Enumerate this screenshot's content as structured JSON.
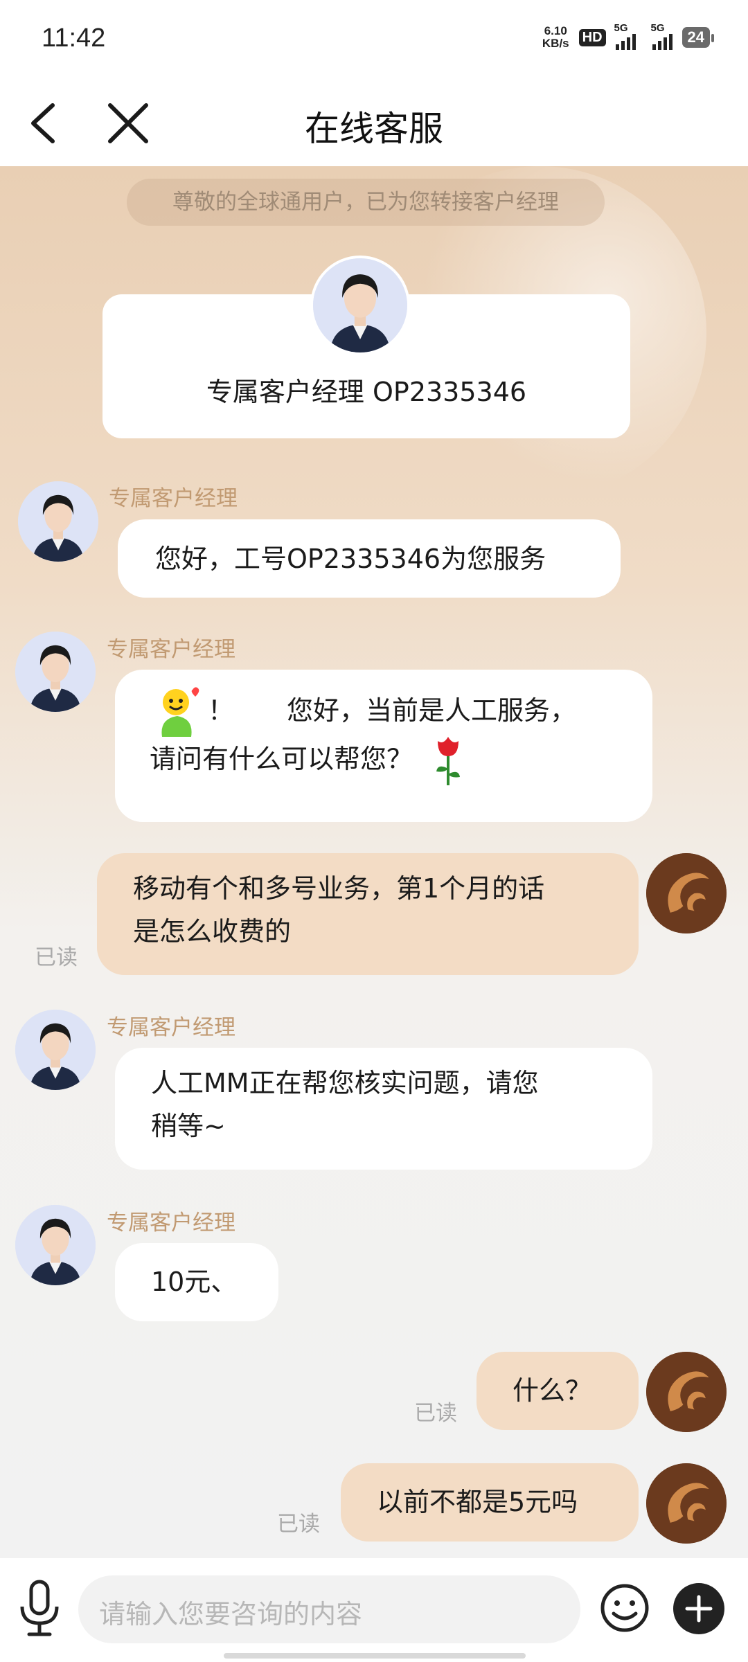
{
  "status_bar": {
    "time": "11:42",
    "net_speed_value": "6.10",
    "net_speed_unit": "KB/s",
    "hd_badge": "HD",
    "signal_1": "5G",
    "signal_2": "5G",
    "battery": "24"
  },
  "header": {
    "title": "在线客服",
    "back_icon": "chevron-left-icon",
    "close_icon": "close-icon"
  },
  "chat": {
    "notice": "尊敬的全球通用户，已为您转接客户经理",
    "manager_card": {
      "name": "专属客户经理 OP2335346"
    },
    "messages": [
      {
        "from": "agent",
        "sender": "专属客户经理",
        "text": "您好，工号OP2335346为您服务"
      },
      {
        "from": "agent",
        "sender": "专属客户经理",
        "line1": "！　　您好，当前是人工服务，",
        "line2": "请问有什么可以帮您？",
        "emoji_1": "waving-smiley-icon",
        "emoji_2": "rose-icon"
      },
      {
        "from": "me",
        "line1": "移动有个和多号业务，第1个月的话",
        "line2": "是怎么收费的",
        "read": "已读"
      },
      {
        "from": "agent",
        "sender": "专属客户经理",
        "line1": "人工MM正在帮您核实问题，请您",
        "line2": "稍等~"
      },
      {
        "from": "agent",
        "sender": "专属客户经理",
        "text": "10元、"
      },
      {
        "from": "me",
        "text": "什么？",
        "read": "已读"
      },
      {
        "from": "me",
        "text": "以前不都是5元吗",
        "read": "已读"
      }
    ]
  },
  "input_bar": {
    "placeholder": "请输入您要咨询的内容",
    "mic_icon": "microphone-icon",
    "emoji_icon": "smiley-icon",
    "plus_icon": "plus-icon"
  },
  "colors": {
    "accent_sender": "#c19a72",
    "my_bubble": "#f3dcc5",
    "agent_bubble": "#ffffff",
    "user_avatar": "#6b3a1e"
  }
}
